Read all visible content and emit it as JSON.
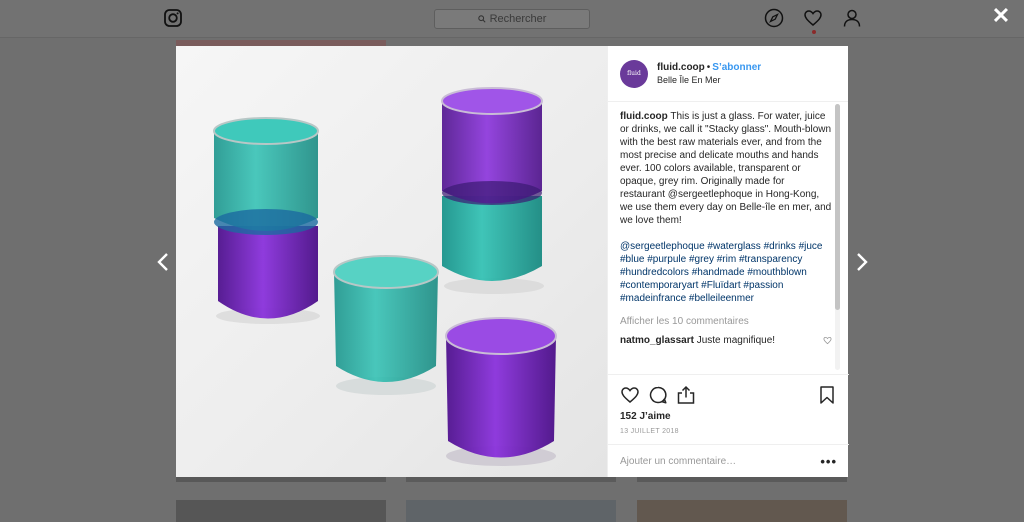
{
  "topbar": {
    "search_placeholder": "Rechercher"
  },
  "post": {
    "username": "fluid.coop",
    "follow_label": "S’abonner",
    "location": "Belle Île En Mer",
    "avatar_text": "fluid",
    "caption_user": "fluid.coop",
    "caption_text": " This is just a glass. For water, juice or drinks, we call it \"Stacky glass\". Mouth-blown with the best raw materials ever, and from the most precise and delicate mouths and hands ever. 100 colors available, transparent or opaque, grey rim. Originally made for restaurant @sergeetlephoque in Hong-Kong, we use them every day on Belle-île en mer, and we love them!",
    "hashtags": "@sergeetlephoque #waterglass #drinks #juce #blue #purpule #grey #rim #transparency #hundredcolors #handmade #mouthblown #contemporaryart #Fluïdart #passion #madeinfrance #belleileenmer",
    "view_all_comments": "Afficher les 10 commentaires",
    "comment": {
      "user": "natmo_glassart",
      "text": " Juste magnifique!"
    },
    "likes": "152 J’aime",
    "date": "13 JUILLET 2018",
    "add_comment_placeholder": "Ajouter un commentaire…",
    "more_label": "•••"
  },
  "colors": {
    "link_blue": "#3897f0",
    "hashtag": "#003569",
    "teal_glass": "#1aa79c",
    "purple_glass": "#7a22c8"
  },
  "icons": [
    "instagram-icon",
    "search-icon",
    "compass-icon",
    "heart-icon",
    "user-icon",
    "close-icon",
    "chevron-left-icon",
    "chevron-right-icon",
    "comment-icon",
    "share-icon",
    "bookmark-icon"
  ]
}
